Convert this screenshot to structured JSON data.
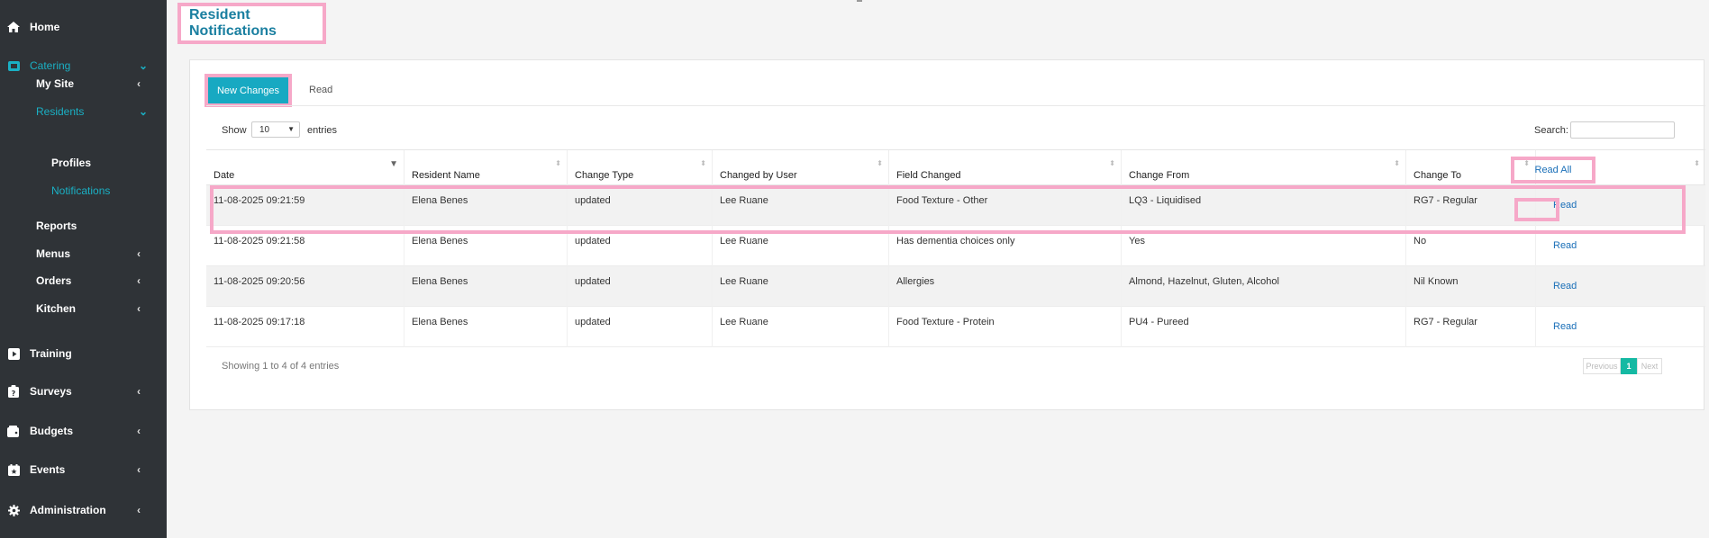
{
  "sidebar": {
    "home": "Home",
    "catering": "Catering",
    "my_site": "My Site",
    "residents": "Residents",
    "profiles": "Profiles",
    "notifications": "Notifications",
    "reports": "Reports",
    "menus": "Menus",
    "orders": "Orders",
    "kitchen": "Kitchen",
    "training": "Training",
    "surveys": "Surveys",
    "budgets": "Budgets",
    "events": "Events",
    "administration": "Administration",
    "chevron_left": "‹",
    "chevron_down": "⌄"
  },
  "page": {
    "title": "Resident Notifications"
  },
  "tabs": {
    "new_changes": "New Changes",
    "read": "Read"
  },
  "controls": {
    "show": "Show",
    "entries_value": "10",
    "entries": "entries",
    "search": "Search:"
  },
  "table": {
    "headers": [
      "Date",
      "Resident Name",
      "Change Type",
      "Changed by User",
      "Field Changed",
      "Change From",
      "Change To"
    ],
    "read_all": "Read All",
    "read_label": "Read",
    "rows": [
      [
        "11-08-2025 09:21:59",
        "Elena Benes",
        "updated",
        "Lee Ruane",
        "Food Texture - Other",
        "LQ3 - Liquidised",
        "RG7 - Regular"
      ],
      [
        "11-08-2025 09:21:58",
        "Elena Benes",
        "updated",
        "Lee Ruane",
        "Has dementia choices only",
        "Yes",
        "No"
      ],
      [
        "11-08-2025 09:20:56",
        "Elena Benes",
        "updated",
        "Lee Ruane",
        "Allergies",
        "Almond, Hazelnut, Gluten, Alcohol",
        "Nil Known"
      ],
      [
        "11-08-2025 09:17:18",
        "Elena Benes",
        "updated",
        "Lee Ruane",
        "Food Texture - Protein",
        "PU4 - Pureed",
        "RG7 - Regular"
      ]
    ]
  },
  "footer": {
    "showing": "Showing 1 to 4 of 4 entries",
    "previous": "Previous",
    "page": "1",
    "next": "Next"
  },
  "colors": {
    "sidebar_bg": "#2f3337",
    "accent": "#1ab0c4",
    "highlight": "#f6a8c8",
    "link": "#1a6fb8",
    "pager_active": "#15b9a3"
  }
}
